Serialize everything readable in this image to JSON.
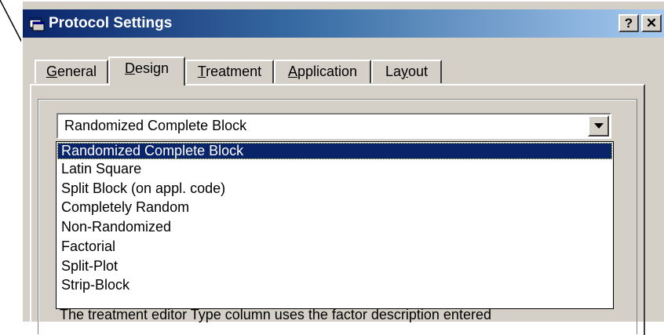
{
  "window": {
    "title": "Protocol Settings",
    "help_label": "?",
    "close_label": "✕"
  },
  "tabs": [
    {
      "label": "General",
      "mnemonic": "G",
      "rest": "eneral",
      "active": false
    },
    {
      "label": "Design",
      "mnemonic": "D",
      "rest": "esign",
      "active": true
    },
    {
      "label": "Treatment",
      "mnemonic": "T",
      "rest": "reatment",
      "active": false
    },
    {
      "label": "Application",
      "mnemonic": "A",
      "rest": "pplication",
      "active": false
    },
    {
      "label": "Layout",
      "pre": "La",
      "mnemonic": "y",
      "rest": "out",
      "active": false
    }
  ],
  "design_combo": {
    "selected_value": "Randomized Complete Block",
    "options": [
      "Randomized Complete Block",
      "Latin Square",
      "Split Block (on appl. code)",
      "Completely Random",
      "Non-Randomized",
      "Factorial",
      "Split-Plot",
      "Strip-Block"
    ],
    "highlighted_index": 0
  },
  "partial_text": "The treatment editor Type column uses the factor description entered",
  "colors": {
    "titlebar_start": "#0a246a",
    "titlebar_end": "#a6caf0",
    "face": "#d4d0c8",
    "selection": "#0a246a"
  },
  "icons": {
    "window_icon": "protocol-window-icon",
    "dropdown_arrow": "chevron-down-icon"
  }
}
